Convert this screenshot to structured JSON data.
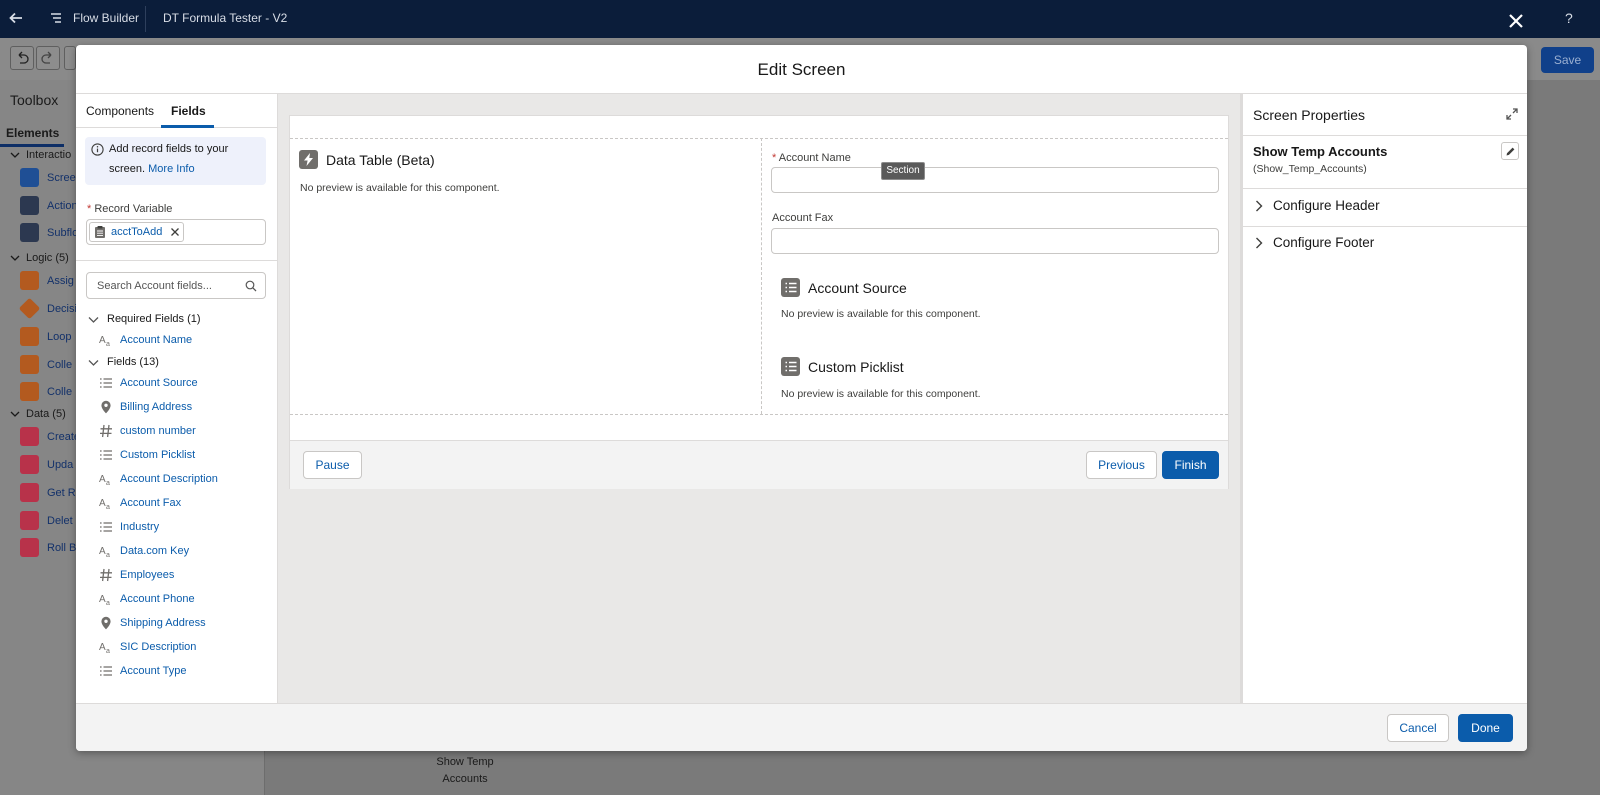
{
  "app": {
    "name": "Flow Builder",
    "flow_name": "DT Formula Tester - V2",
    "help": "?",
    "save_label": "Save"
  },
  "toolbox": {
    "title": "Toolbox",
    "tab": "Elements",
    "groups": {
      "interaction": "Interactio",
      "logic": "Logic (5)",
      "data": "Data (5)"
    },
    "items": {
      "screen": "Scree",
      "action": "Action",
      "subflow": "Subflo",
      "assignment": "Assig",
      "decision": "Decisi",
      "loop": "Loop",
      "collection_sort": "Colle",
      "collection_filter": "Colle",
      "create": "Create",
      "update": "Upda",
      "get": "Get R",
      "delete": "Delet",
      "rollback": "Roll B"
    }
  },
  "canvas": {
    "node_label_line1": "Show Temp",
    "node_label_line2": "Accounts"
  },
  "modal": {
    "title": "Edit Screen",
    "cancel_label": "Cancel",
    "done_label": "Done"
  },
  "left_panel": {
    "tabs": [
      "Components",
      "Fields"
    ],
    "active_tab": "Fields",
    "info_text": "Add record fields to your screen.",
    "info_link": "More Info",
    "record_variable_label": "Record Variable",
    "required_mark": "*",
    "record_variable_value": "acctToAdd",
    "search_placeholder": "Search Account fields...",
    "required_group": "Required Fields (1)",
    "required_fields": [
      {
        "label": "Account Name",
        "icon": "text-icon"
      }
    ],
    "fields_group": "Fields (13)",
    "fields": [
      {
        "label": "Account Source",
        "icon": "picklist-icon"
      },
      {
        "label": "Billing Address",
        "icon": "location-pin-icon"
      },
      {
        "label": "custom number",
        "icon": "number-icon"
      },
      {
        "label": "Custom Picklist",
        "icon": "picklist-icon"
      },
      {
        "label": "Account Description",
        "icon": "text-icon"
      },
      {
        "label": "Account Fax",
        "icon": "text-icon"
      },
      {
        "label": "Industry",
        "icon": "picklist-icon"
      },
      {
        "label": "Data.com Key",
        "icon": "text-icon"
      },
      {
        "label": "Employees",
        "icon": "number-icon"
      },
      {
        "label": "Account Phone",
        "icon": "text-icon"
      },
      {
        "label": "Shipping Address",
        "icon": "location-pin-icon"
      },
      {
        "label": "SIC Description",
        "icon": "text-icon"
      },
      {
        "label": "Account Type",
        "icon": "picklist-icon"
      }
    ]
  },
  "screen_canvas": {
    "data_table_title": "Data Table (Beta)",
    "no_preview": "No preview is available for this component.",
    "account_name_label": "Account Name",
    "section_tooltip": "Section",
    "account_fax_label": "Account Fax",
    "account_source_title": "Account Source",
    "custom_picklist_title": "Custom Picklist",
    "pause_label": "Pause",
    "previous_label": "Previous",
    "finish_label": "Finish"
  },
  "right_panel": {
    "title": "Screen Properties",
    "screen_label": "Show Temp Accounts",
    "api_name": "(Show_Temp_Accounts)",
    "sections": [
      "Configure Header",
      "Configure Footer"
    ]
  },
  "colors": {
    "brand": "#0b5cab",
    "header_bg": "#0b1d3a",
    "required": "#c23934"
  }
}
